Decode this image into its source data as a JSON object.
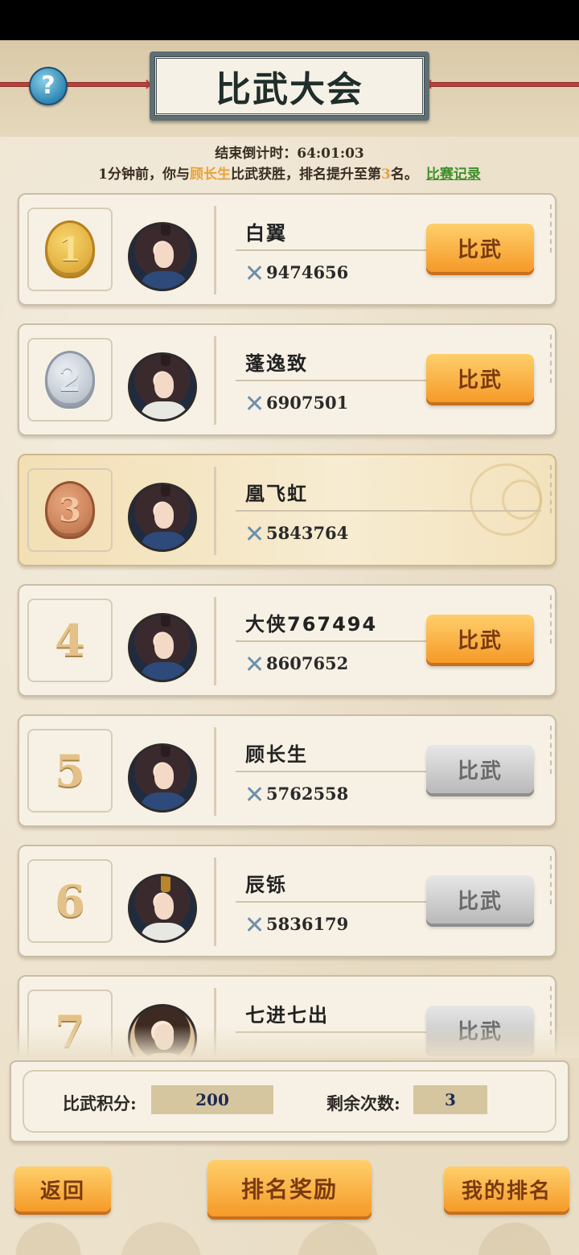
{
  "header": {
    "title": "比武大会",
    "help_glyph": "?"
  },
  "countdown": {
    "label": "结束倒计时：",
    "value": "64:01:03"
  },
  "notice": {
    "prefix": "1分钟前，你与",
    "opponent": "顾长生",
    "middle": "比武获胜，排名提升至第",
    "rank": "3",
    "suffix": "名。",
    "link": "比赛记录"
  },
  "ranking": [
    {
      "rank": "1",
      "badge": "gold",
      "name": "白翼",
      "power": "9474656",
      "button": "比武",
      "button_state": "active",
      "avatar": "woman-dark-robe"
    },
    {
      "rank": "2",
      "badge": "silver",
      "name": "蓬逸致",
      "power": "6907501",
      "button": "比武",
      "button_state": "active",
      "avatar": "man-white-robe"
    },
    {
      "rank": "3",
      "badge": "bronze",
      "name": "凰飞虹",
      "power": "5843764",
      "button": "",
      "button_state": "self",
      "avatar": "woman-dark-robe"
    },
    {
      "rank": "4",
      "badge": "number",
      "name": "大侠767494",
      "power": "8607652",
      "button": "比武",
      "button_state": "active",
      "avatar": "woman-dark-robe"
    },
    {
      "rank": "5",
      "badge": "number",
      "name": "顾长生",
      "power": "5762558",
      "button": "比武",
      "button_state": "disabled",
      "avatar": "woman-dark-robe"
    },
    {
      "rank": "6",
      "badge": "number",
      "name": "辰铄",
      "power": "5836179",
      "button": "比武",
      "button_state": "disabled",
      "avatar": "man-crown"
    },
    {
      "rank": "7",
      "badge": "number",
      "name": "七进七出",
      "power": "",
      "button": "比武",
      "button_state": "disabled",
      "avatar": "girl"
    }
  ],
  "stats": {
    "score_label": "比武积分:",
    "score_value": "200",
    "remaining_label": "剩余次数:",
    "remaining_value": "3"
  },
  "footer": {
    "back": "返回",
    "rewards": "排名奖励",
    "my_rank": "我的排名"
  },
  "colors": {
    "highlight": "#e8a23b",
    "link": "#3f8f2a",
    "button_orange": "#f59a28",
    "button_gray": "#b9b9b9"
  }
}
